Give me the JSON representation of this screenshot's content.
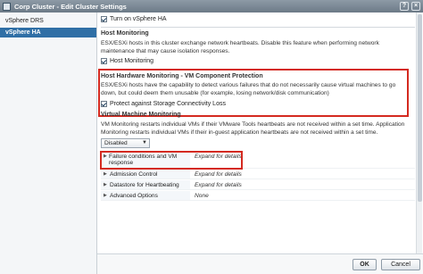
{
  "window": {
    "title": "Corp Cluster - Edit Cluster Settings",
    "help": "?",
    "close": "×"
  },
  "sidebar": {
    "items": [
      {
        "label": "vSphere DRS"
      },
      {
        "label": "vSphere HA"
      }
    ]
  },
  "ha": {
    "turn_on_label": "Turn on vSphere HA",
    "turn_on_checked": true
  },
  "host_monitoring": {
    "heading": "Host Monitoring",
    "description": "ESX/ESXi hosts in this cluster exchange network heartbeats. Disable this feature when performing network maintenance that may cause isolation responses.",
    "checkbox_label": "Host Monitoring",
    "checked": true
  },
  "host_hardware": {
    "heading": "Host Hardware Monitoring - VM Component Protection",
    "description": "ESX/ESXi hosts have the capability to detect various failures that do not necessarily cause virtual machines to go down, but could deem them unusable (for example, losing network/disk communication)",
    "checkbox_label": "Protect against Storage Connectivity Loss",
    "checked": true
  },
  "vm_monitoring": {
    "heading": "Virtual Machine Monitoring",
    "description": "VM Monitoring restarts individual VMs if their VMware Tools heartbeats are not received within a set time. Application Monitoring restarts individual VMs if their in-guest application heartbeats are not received within a set time.",
    "select_value": "Disabled"
  },
  "settings_rows": [
    {
      "label": "Failure conditions and VM response",
      "value": "Expand for details"
    },
    {
      "label": "Admission Control",
      "value": "Expand for details"
    },
    {
      "label": "Datastore for Heartbeating",
      "value": "Expand for details"
    },
    {
      "label": "Advanced Options",
      "value": "None"
    }
  ],
  "footer": {
    "ok_label": "OK",
    "cancel_label": "Cancel"
  },
  "colors": {
    "accent": "#2f6fa6",
    "highlight_box": "#d42a20"
  }
}
